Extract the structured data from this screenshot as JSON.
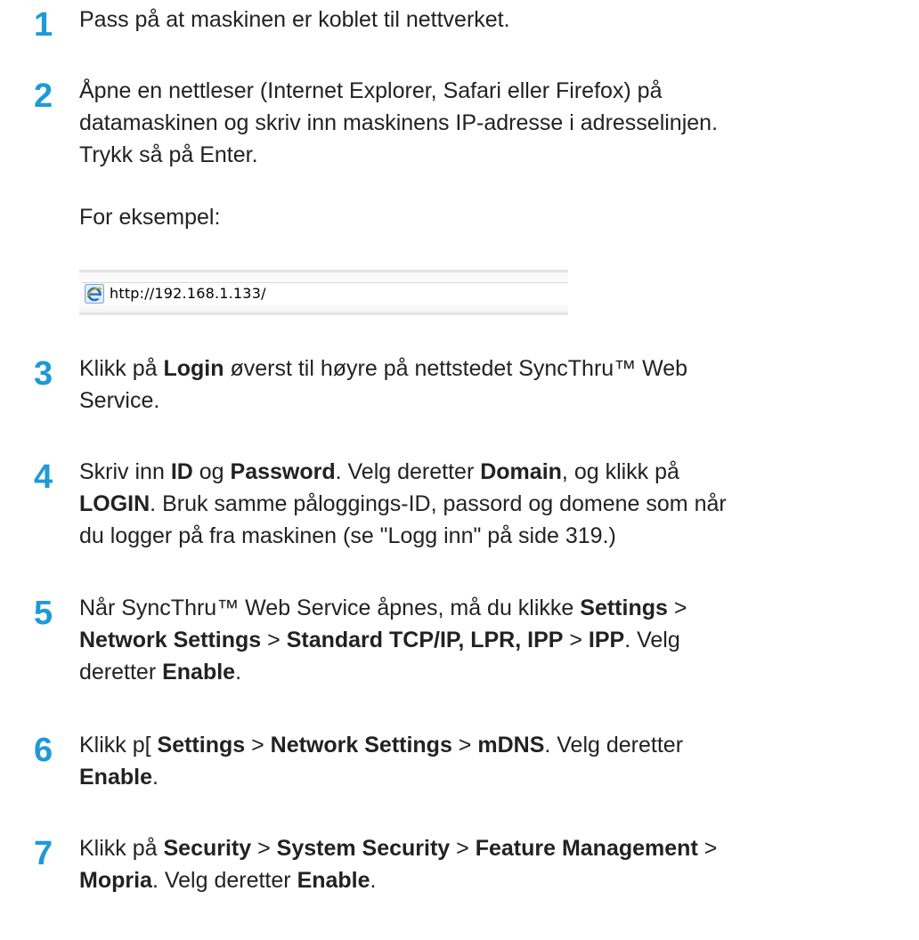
{
  "steps": [
    {
      "number": "1",
      "lines": [
        [
          {
            "t": "Pass på at maskinen er koblet til nettverket."
          }
        ]
      ]
    },
    {
      "number": "2",
      "lines": [
        [
          {
            "t": "Åpne en nettleser (Internet Explorer, Safari eller Firefox) på"
          }
        ],
        [
          {
            "t": "datamaskinen og skriv inn maskinens IP-adresse i adresselinjen."
          }
        ],
        [
          {
            "t": "Trykk så på Enter."
          }
        ]
      ]
    },
    {
      "number": "3",
      "lines": [
        [
          {
            "t": "Klikk på "
          },
          {
            "t": "Login",
            "b": true
          },
          {
            "t": " øverst til høyre på nettstedet SyncThru™ Web"
          }
        ],
        [
          {
            "t": "Service."
          }
        ]
      ]
    },
    {
      "number": "4",
      "lines": [
        [
          {
            "t": "Skriv inn "
          },
          {
            "t": "ID",
            "b": true
          },
          {
            "t": " og "
          },
          {
            "t": "Password",
            "b": true
          },
          {
            "t": ". Velg deretter "
          },
          {
            "t": "Domain",
            "b": true
          },
          {
            "t": ", og klikk på"
          }
        ],
        [
          {
            "t": "LOGIN",
            "b": true
          },
          {
            "t": ". Bruk samme påloggings-ID, passord og domene som når"
          }
        ],
        [
          {
            "t": "du logger på fra maskinen (se \"Logg inn\" på side 319.)"
          }
        ]
      ]
    },
    {
      "number": "5",
      "lines": [
        [
          {
            "t": "Når SyncThru™ Web Service åpnes, må du klikke "
          },
          {
            "t": "Settings",
            "b": true
          },
          {
            "t": " >"
          }
        ],
        [
          {
            "t": "Network Settings",
            "b": true
          },
          {
            "t": " > "
          },
          {
            "t": "Standard TCP/IP, LPR, IPP",
            "b": true
          },
          {
            "t": " > "
          },
          {
            "t": "IPP",
            "b": true
          },
          {
            "t": ". Velg"
          }
        ],
        [
          {
            "t": "deretter "
          },
          {
            "t": "Enable",
            "b": true
          },
          {
            "t": "."
          }
        ]
      ]
    },
    {
      "number": "6",
      "lines": [
        [
          {
            "t": "Klikk p[ "
          },
          {
            "t": "Settings",
            "b": true
          },
          {
            "t": " > "
          },
          {
            "t": "Network Settings",
            "b": true
          },
          {
            "t": " > "
          },
          {
            "t": "mDNS",
            "b": true
          },
          {
            "t": ". Velg deretter"
          }
        ],
        [
          {
            "t": "Enable",
            "b": true
          },
          {
            "t": "."
          }
        ]
      ]
    },
    {
      "number": "7",
      "lines": [
        [
          {
            "t": "Klikk på "
          },
          {
            "t": "Security",
            "b": true
          },
          {
            "t": " > "
          },
          {
            "t": "System Security",
            "b": true
          },
          {
            "t": " > "
          },
          {
            "t": "Feature Management",
            "b": true
          },
          {
            "t": " >"
          }
        ],
        [
          {
            "t": "Mopria",
            "b": true
          },
          {
            "t": ". Velg deretter "
          },
          {
            "t": "Enable",
            "b": true
          },
          {
            "t": "."
          }
        ]
      ]
    }
  ],
  "example": {
    "label": "For eksempel:",
    "address_bar": {
      "icon": "ie-icon",
      "url": "http://192.168.1.133/"
    }
  },
  "colors": {
    "step_number": "#1e9ad6",
    "text": "#222222"
  }
}
